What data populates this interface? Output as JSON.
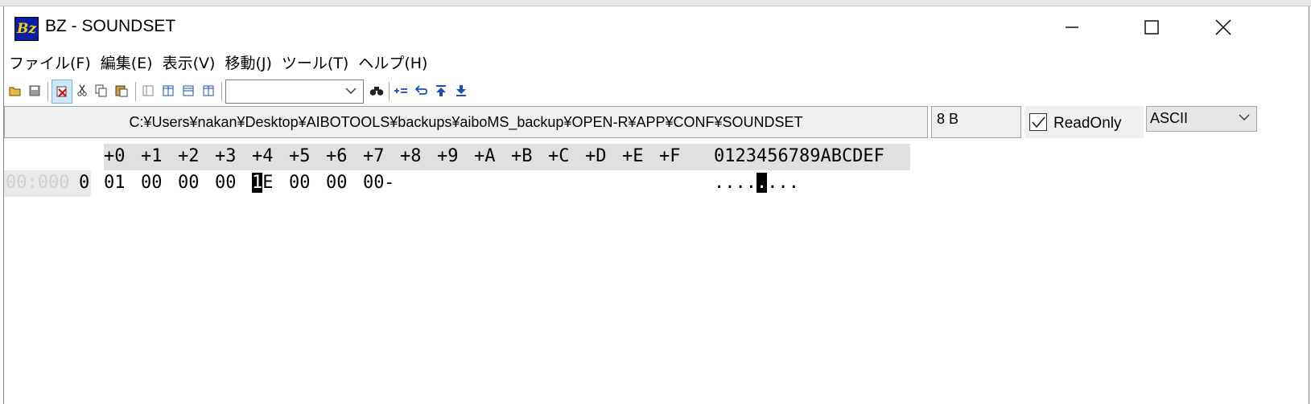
{
  "window": {
    "title": "BZ - SOUNDSET",
    "app_icon_text": "Bz"
  },
  "menu": [
    {
      "label": "ファイル(F)"
    },
    {
      "label": "編集(E)"
    },
    {
      "label": "表示(V)"
    },
    {
      "label": "移動(J)"
    },
    {
      "label": "ツール(T)"
    },
    {
      "label": "ヘルプ(H)"
    }
  ],
  "toolbar": {
    "icons": [
      "open-icon",
      "save-icon",
      "delete-icon",
      "cut-icon",
      "copy-icon",
      "paste-icon",
      "view-single-icon",
      "view-split-vertical-icon",
      "view-split-horizontal-icon",
      "view-split-compare-icon"
    ],
    "search_value": "",
    "nav_icons": [
      "find-icon",
      "add-bookmark-icon",
      "back-icon",
      "jump-top-icon",
      "jump-bottom-icon"
    ]
  },
  "status": {
    "path": "C:¥Users¥nakan¥Desktop¥AIBOTOOLS¥backups¥aiboMS_backup¥OPEN-R¥APP¥CONF¥SOUNDSET",
    "size": "8 B",
    "readonly_label": "ReadOnly",
    "readonly_checked": true,
    "encoding": "ASCII"
  },
  "hex": {
    "columns": [
      "+0",
      "+1",
      "+2",
      "+3",
      "+4",
      "+5",
      "+6",
      "+7",
      "+8",
      "+9",
      "+A",
      "+B",
      "+C",
      "+D",
      "+E",
      "+F"
    ],
    "ascii_header": "0123456789ABCDEF",
    "rows": [
      {
        "address_faded": "00:000",
        "address_last": "0",
        "bytes": [
          "01",
          "00",
          "00",
          "00",
          "1E",
          "00",
          "00",
          "00"
        ],
        "terminator": "-",
        "ascii_before": "....",
        "ascii_cursor": ".",
        "ascii_after": "..."
      }
    ],
    "cursor_index": 4
  },
  "colors": {
    "header_bg": "#e0e0e0",
    "cursor": "#000000",
    "icon_blue": "#1a4fb8"
  }
}
